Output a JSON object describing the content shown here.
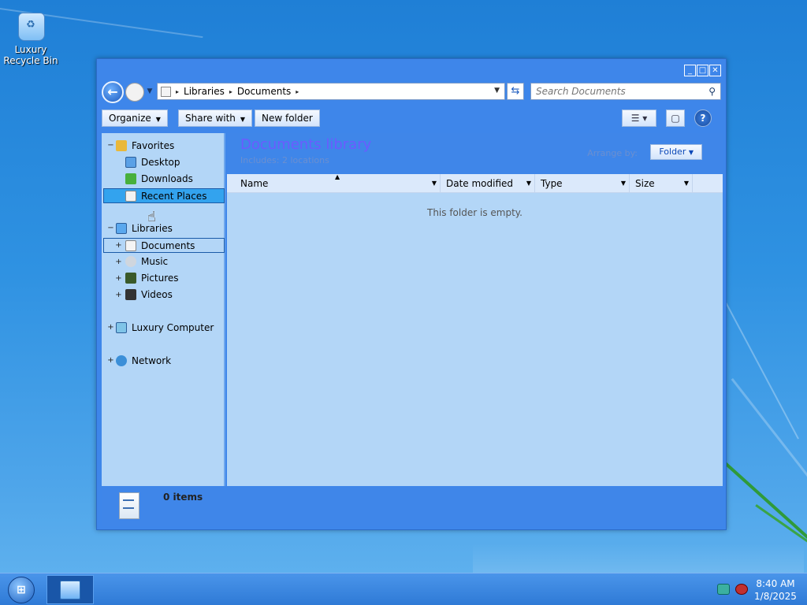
{
  "desktop": {
    "recycle_bin_label": "Luxury Recycle Bin"
  },
  "window": {
    "controls": {
      "minimize": "_",
      "maximize": "□",
      "close": "✕"
    },
    "address": {
      "crumbs": [
        "Libraries",
        "Documents"
      ],
      "separator": "▸"
    },
    "search": {
      "placeholder": "Search Documents"
    },
    "toolbar": {
      "organize": "Organize",
      "share_with": "Share with",
      "new_folder": "New folder"
    },
    "nav": {
      "favorites": "Favorites",
      "desktop": "Desktop",
      "downloads": "Downloads",
      "recent_places": "Recent Places",
      "libraries": "Libraries",
      "documents": "Documents",
      "music": "Music",
      "pictures": "Pictures",
      "videos": "Videos",
      "computer": "Luxury Computer",
      "network": "Network"
    },
    "library": {
      "title": "Documents library",
      "includes": "Includes:  2 locations",
      "arrange_by_label": "Arrange by:",
      "arrange_by_value": "Folder"
    },
    "columns": [
      "Name",
      "Date modified",
      "Type",
      "Size"
    ],
    "empty_message": "This folder is empty.",
    "status": {
      "items": "0 items"
    }
  },
  "taskbar": {
    "time": "8:40 AM",
    "date": "1/8/2025"
  },
  "colors": {
    "window_frame": "#3e86ea",
    "pane": "#b3d6f7",
    "selection": "#33a3ee",
    "library_title": "#6a5cff"
  }
}
